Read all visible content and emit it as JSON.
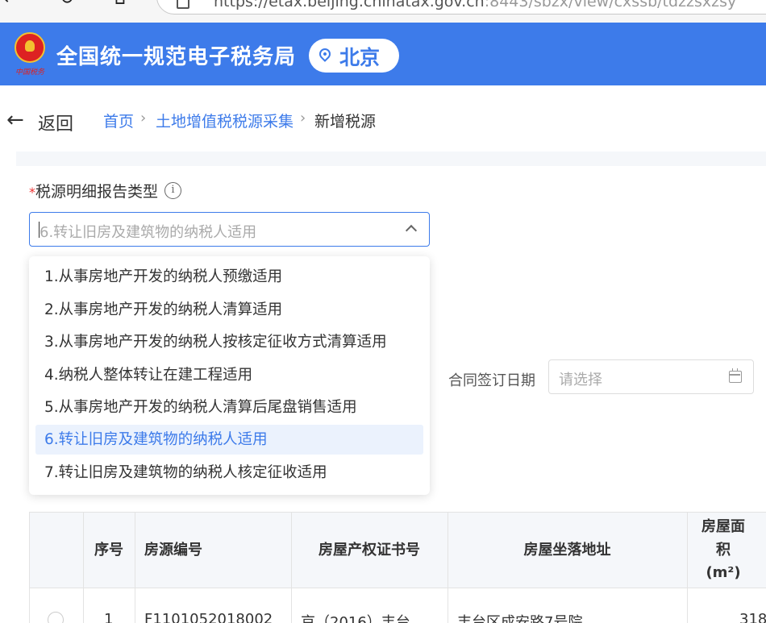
{
  "browser": {
    "url_main": "https://etax.beijing.chinatax.gov.cn",
    "url_rest": ":8443/sbzx/view/cxssb/tdzzsxzsy"
  },
  "header": {
    "logo_text": "中国税务",
    "title": "全国统一规范电子税务局",
    "region": "北京",
    "color": "#3d7bea"
  },
  "nav": {
    "back_label": "返回",
    "breadcrumb": [
      "首页",
      "土地增值税税源采集",
      "新增税源"
    ],
    "separator": "›"
  },
  "form": {
    "required_mark": "*",
    "report_type_label": "税源明细报告类型",
    "report_type_value": "6.转让旧房及建筑物的纳税人适用",
    "options": [
      "1.从事房地产开发的纳税人预缴适用",
      "2.从事房地产开发的纳税人清算适用",
      "3.从事房地产开发的纳税人按核定征收方式清算适用",
      "4.纳税人整体转让在建工程适用",
      "5.从事房地产开发的纳税人清算后尾盘销售适用",
      "6.转让旧房及建筑物的纳税人适用",
      "7.转让旧房及建筑物的纳税人核定征收适用"
    ],
    "selected_index": 5,
    "contract_date_label": "合同签订日期",
    "contract_date_placeholder": "请选择"
  },
  "table": {
    "headers": [
      "序号",
      "房源编号",
      "房屋产权证书号",
      "房屋坐落地址",
      "房屋面积(m²)"
    ],
    "rows": [
      [
        "1",
        "F1101052018002",
        "京（2016）丰台",
        "丰台区成安路7号院",
        "318"
      ]
    ]
  }
}
